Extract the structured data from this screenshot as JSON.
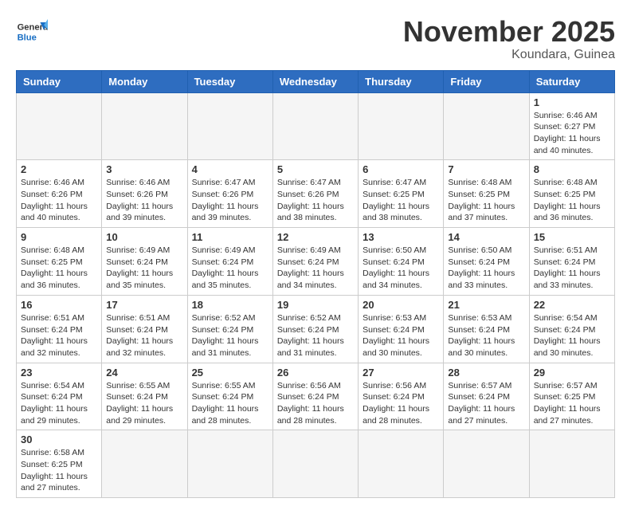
{
  "header": {
    "logo_general": "General",
    "logo_blue": "Blue",
    "month_title": "November 2025",
    "location": "Koundara, Guinea"
  },
  "days_of_week": [
    "Sunday",
    "Monday",
    "Tuesday",
    "Wednesday",
    "Thursday",
    "Friday",
    "Saturday"
  ],
  "weeks": [
    [
      {
        "day": "",
        "info": ""
      },
      {
        "day": "",
        "info": ""
      },
      {
        "day": "",
        "info": ""
      },
      {
        "day": "",
        "info": ""
      },
      {
        "day": "",
        "info": ""
      },
      {
        "day": "",
        "info": ""
      },
      {
        "day": "1",
        "info": "Sunrise: 6:46 AM\nSunset: 6:27 PM\nDaylight: 11 hours and 40 minutes."
      }
    ],
    [
      {
        "day": "2",
        "info": "Sunrise: 6:46 AM\nSunset: 6:26 PM\nDaylight: 11 hours and 40 minutes."
      },
      {
        "day": "3",
        "info": "Sunrise: 6:46 AM\nSunset: 6:26 PM\nDaylight: 11 hours and 39 minutes."
      },
      {
        "day": "4",
        "info": "Sunrise: 6:47 AM\nSunset: 6:26 PM\nDaylight: 11 hours and 39 minutes."
      },
      {
        "day": "5",
        "info": "Sunrise: 6:47 AM\nSunset: 6:26 PM\nDaylight: 11 hours and 38 minutes."
      },
      {
        "day": "6",
        "info": "Sunrise: 6:47 AM\nSunset: 6:25 PM\nDaylight: 11 hours and 38 minutes."
      },
      {
        "day": "7",
        "info": "Sunrise: 6:48 AM\nSunset: 6:25 PM\nDaylight: 11 hours and 37 minutes."
      },
      {
        "day": "8",
        "info": "Sunrise: 6:48 AM\nSunset: 6:25 PM\nDaylight: 11 hours and 36 minutes."
      }
    ],
    [
      {
        "day": "9",
        "info": "Sunrise: 6:48 AM\nSunset: 6:25 PM\nDaylight: 11 hours and 36 minutes."
      },
      {
        "day": "10",
        "info": "Sunrise: 6:49 AM\nSunset: 6:24 PM\nDaylight: 11 hours and 35 minutes."
      },
      {
        "day": "11",
        "info": "Sunrise: 6:49 AM\nSunset: 6:24 PM\nDaylight: 11 hours and 35 minutes."
      },
      {
        "day": "12",
        "info": "Sunrise: 6:49 AM\nSunset: 6:24 PM\nDaylight: 11 hours and 34 minutes."
      },
      {
        "day": "13",
        "info": "Sunrise: 6:50 AM\nSunset: 6:24 PM\nDaylight: 11 hours and 34 minutes."
      },
      {
        "day": "14",
        "info": "Sunrise: 6:50 AM\nSunset: 6:24 PM\nDaylight: 11 hours and 33 minutes."
      },
      {
        "day": "15",
        "info": "Sunrise: 6:51 AM\nSunset: 6:24 PM\nDaylight: 11 hours and 33 minutes."
      }
    ],
    [
      {
        "day": "16",
        "info": "Sunrise: 6:51 AM\nSunset: 6:24 PM\nDaylight: 11 hours and 32 minutes."
      },
      {
        "day": "17",
        "info": "Sunrise: 6:51 AM\nSunset: 6:24 PM\nDaylight: 11 hours and 32 minutes."
      },
      {
        "day": "18",
        "info": "Sunrise: 6:52 AM\nSunset: 6:24 PM\nDaylight: 11 hours and 31 minutes."
      },
      {
        "day": "19",
        "info": "Sunrise: 6:52 AM\nSunset: 6:24 PM\nDaylight: 11 hours and 31 minutes."
      },
      {
        "day": "20",
        "info": "Sunrise: 6:53 AM\nSunset: 6:24 PM\nDaylight: 11 hours and 30 minutes."
      },
      {
        "day": "21",
        "info": "Sunrise: 6:53 AM\nSunset: 6:24 PM\nDaylight: 11 hours and 30 minutes."
      },
      {
        "day": "22",
        "info": "Sunrise: 6:54 AM\nSunset: 6:24 PM\nDaylight: 11 hours and 30 minutes."
      }
    ],
    [
      {
        "day": "23",
        "info": "Sunrise: 6:54 AM\nSunset: 6:24 PM\nDaylight: 11 hours and 29 minutes."
      },
      {
        "day": "24",
        "info": "Sunrise: 6:55 AM\nSunset: 6:24 PM\nDaylight: 11 hours and 29 minutes."
      },
      {
        "day": "25",
        "info": "Sunrise: 6:55 AM\nSunset: 6:24 PM\nDaylight: 11 hours and 28 minutes."
      },
      {
        "day": "26",
        "info": "Sunrise: 6:56 AM\nSunset: 6:24 PM\nDaylight: 11 hours and 28 minutes."
      },
      {
        "day": "27",
        "info": "Sunrise: 6:56 AM\nSunset: 6:24 PM\nDaylight: 11 hours and 28 minutes."
      },
      {
        "day": "28",
        "info": "Sunrise: 6:57 AM\nSunset: 6:24 PM\nDaylight: 11 hours and 27 minutes."
      },
      {
        "day": "29",
        "info": "Sunrise: 6:57 AM\nSunset: 6:25 PM\nDaylight: 11 hours and 27 minutes."
      }
    ],
    [
      {
        "day": "30",
        "info": "Sunrise: 6:58 AM\nSunset: 6:25 PM\nDaylight: 11 hours and 27 minutes."
      },
      {
        "day": "",
        "info": ""
      },
      {
        "day": "",
        "info": ""
      },
      {
        "day": "",
        "info": ""
      },
      {
        "day": "",
        "info": ""
      },
      {
        "day": "",
        "info": ""
      },
      {
        "day": "",
        "info": ""
      }
    ]
  ]
}
